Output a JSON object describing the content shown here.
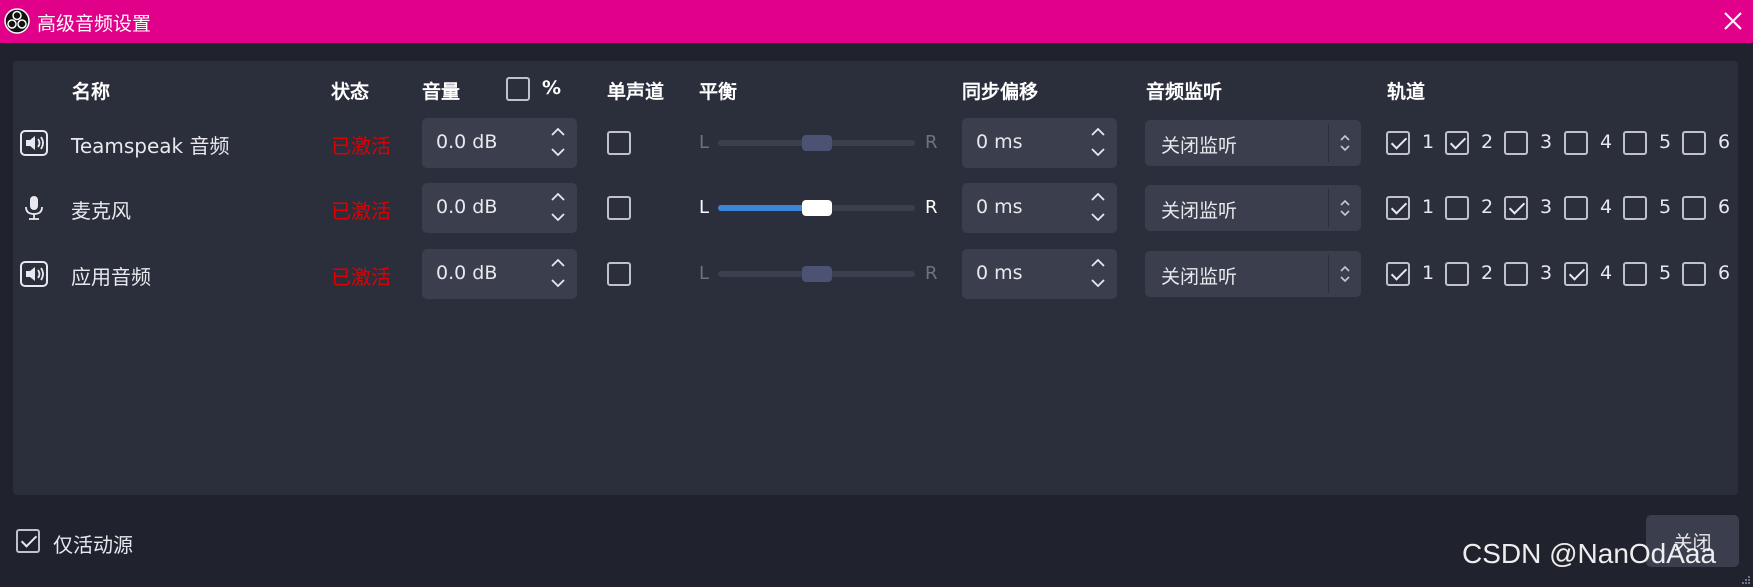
{
  "window": {
    "title": "高级音频设置"
  },
  "header": {
    "name": "名称",
    "status": "状态",
    "volume": "音量",
    "percent": "%",
    "mono": "单声道",
    "balance": "平衡",
    "sync_offset": "同步偏移",
    "monitoring": "音频监听",
    "tracks": "轨道"
  },
  "percent_checked": false,
  "rows": [
    {
      "icon": "speaker-icon",
      "name": "Teamspeak 音频",
      "status": "已激活",
      "volume": "0.0 dB",
      "mono": false,
      "balance_left": "L",
      "balance_right": "R",
      "balance_enabled": false,
      "balance_position": 0.5,
      "sync_offset": "0 ms",
      "monitoring": "关闭监听",
      "tracks": [
        true,
        true,
        false,
        false,
        false,
        false
      ]
    },
    {
      "icon": "microphone-icon",
      "name": "麦克风",
      "status": "已激活",
      "volume": "0.0 dB",
      "mono": false,
      "balance_left": "L",
      "balance_right": "R",
      "balance_enabled": true,
      "balance_position": 0.5,
      "sync_offset": "0 ms",
      "monitoring": "关闭监听",
      "tracks": [
        true,
        false,
        true,
        false,
        false,
        false
      ]
    },
    {
      "icon": "speaker-icon",
      "name": "应用音频",
      "status": "已激活",
      "volume": "0.0 dB",
      "mono": false,
      "balance_left": "L",
      "balance_right": "R",
      "balance_enabled": false,
      "balance_position": 0.5,
      "sync_offset": "0 ms",
      "monitoring": "关闭监听",
      "tracks": [
        true,
        false,
        false,
        true,
        false,
        false
      ]
    }
  ],
  "track_labels": [
    "1",
    "2",
    "3",
    "4",
    "5",
    "6"
  ],
  "footer": {
    "active_only_label": "仅活动源",
    "active_only_checked": true,
    "close_button": "关闭"
  },
  "watermark": "CSDN @NanOdAaa",
  "colors": {
    "titlebar": "#e1008a",
    "status_active": "#e00000",
    "balance_accent": "#3c86d9"
  }
}
